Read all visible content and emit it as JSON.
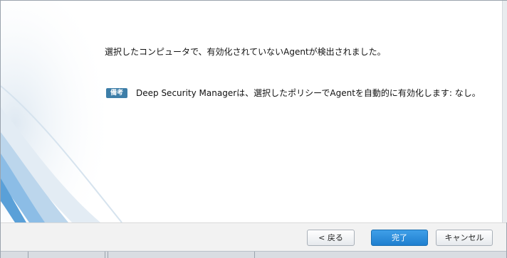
{
  "dialog": {
    "message": "選択したコンピュータで、有効化されていないAgentが検出されました。",
    "note_label": "備考",
    "note_text": "Deep Security Managerは、選択したポリシーでAgentを自動的に有効化します: なし。"
  },
  "buttons": {
    "back": "< 戻る",
    "finish": "完了",
    "cancel": "キャンセル"
  },
  "colors": {
    "note_badge": "#3d7ea8",
    "primary_button": "#2388d8",
    "decor_blue": "#7fb6e0"
  }
}
